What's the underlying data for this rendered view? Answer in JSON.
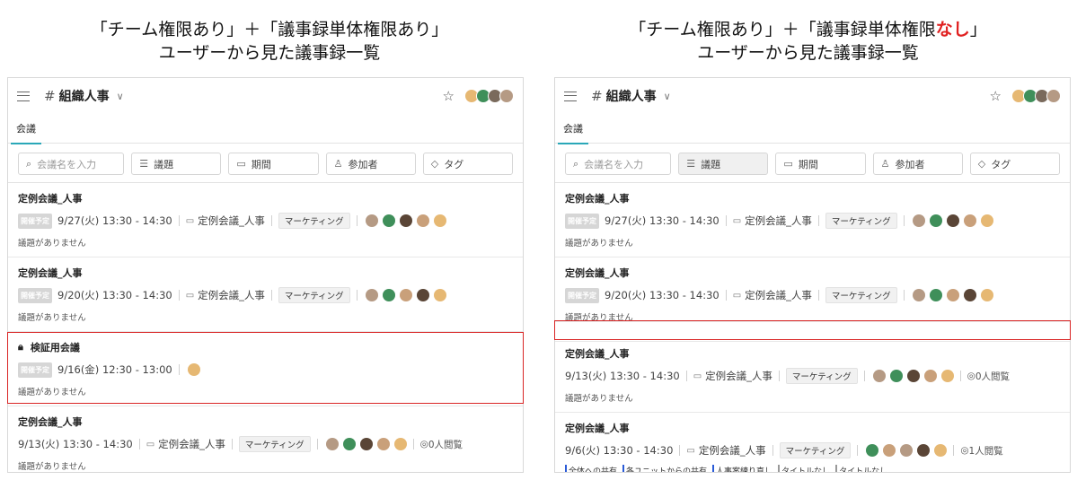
{
  "captions": {
    "left_line1": "「チーム権限あり」＋「議事録単体権限あり」",
    "left_line2": "ユーザーから見た議事録一覧",
    "right_line1_a": "「チーム権限あり」＋「議事録単体権限",
    "right_line1_b": "なし",
    "right_line1_c": "」",
    "right_line2": "ユーザーから見た議事録一覧"
  },
  "colors": {
    "accent_tab": "#2aa8b8",
    "highlight": "#d92525",
    "badge_bg": "#d6d6d6"
  },
  "header": {
    "hash": "#",
    "channel": "組織人事",
    "chevron": "∨",
    "star": "☆"
  },
  "tabs": {
    "meeting": "会議"
  },
  "filters": {
    "search_placeholder": "会議名を入力",
    "agenda": "議題",
    "period": "期間",
    "participants": "参加者",
    "tag": "タグ"
  },
  "left": {
    "meetings": [
      {
        "title": "定例会議_人事",
        "badge": "開催予定",
        "datetime": "9/27(火) 13:30 - 14:30",
        "folder": "定例会議_人事",
        "tag": "マーケティング",
        "agenda": "議題がありません"
      },
      {
        "title": "定例会議_人事",
        "badge": "開催予定",
        "datetime": "9/20(火) 13:30 - 14:30",
        "folder": "定例会議_人事",
        "tag": "マーケティング",
        "agenda": "議題がありません"
      },
      {
        "title": "検証用会議",
        "badge": "開催予定",
        "datetime": "9/16(金) 12:30 - 13:00",
        "agenda": "議題がありません"
      },
      {
        "title": "定例会議_人事",
        "datetime": "9/13(火) 13:30 - 14:30",
        "folder": "定例会議_人事",
        "tag": "マーケティング",
        "views": "0人閲覧",
        "agenda": "議題がありません"
      }
    ]
  },
  "right": {
    "meetings": [
      {
        "title": "定例会議_人事",
        "badge": "開催予定",
        "datetime": "9/27(火) 13:30 - 14:30",
        "folder": "定例会議_人事",
        "tag": "マーケティング",
        "agenda": "議題がありません"
      },
      {
        "title": "定例会議_人事",
        "badge": "開催予定",
        "datetime": "9/20(火) 13:30 - 14:30",
        "folder": "定例会議_人事",
        "tag": "マーケティング",
        "agenda": "議題がありません"
      },
      {
        "title": "定例会議_人事",
        "datetime": "9/13(火) 13:30 - 14:30",
        "folder": "定例会議_人事",
        "tag": "マーケティング",
        "views": "0人閲覧",
        "agenda": "議題がありません"
      },
      {
        "title": "定例会議_人事",
        "datetime": "9/6(火) 13:30 - 14:30",
        "folder": "定例会議_人事",
        "tag": "マーケティング",
        "views": "1人閲覧",
        "tags": [
          "全体への共有",
          "各ユニットからの共有",
          "人事案練り直し",
          "タイトルなし",
          "タイトルなし"
        ]
      }
    ]
  }
}
